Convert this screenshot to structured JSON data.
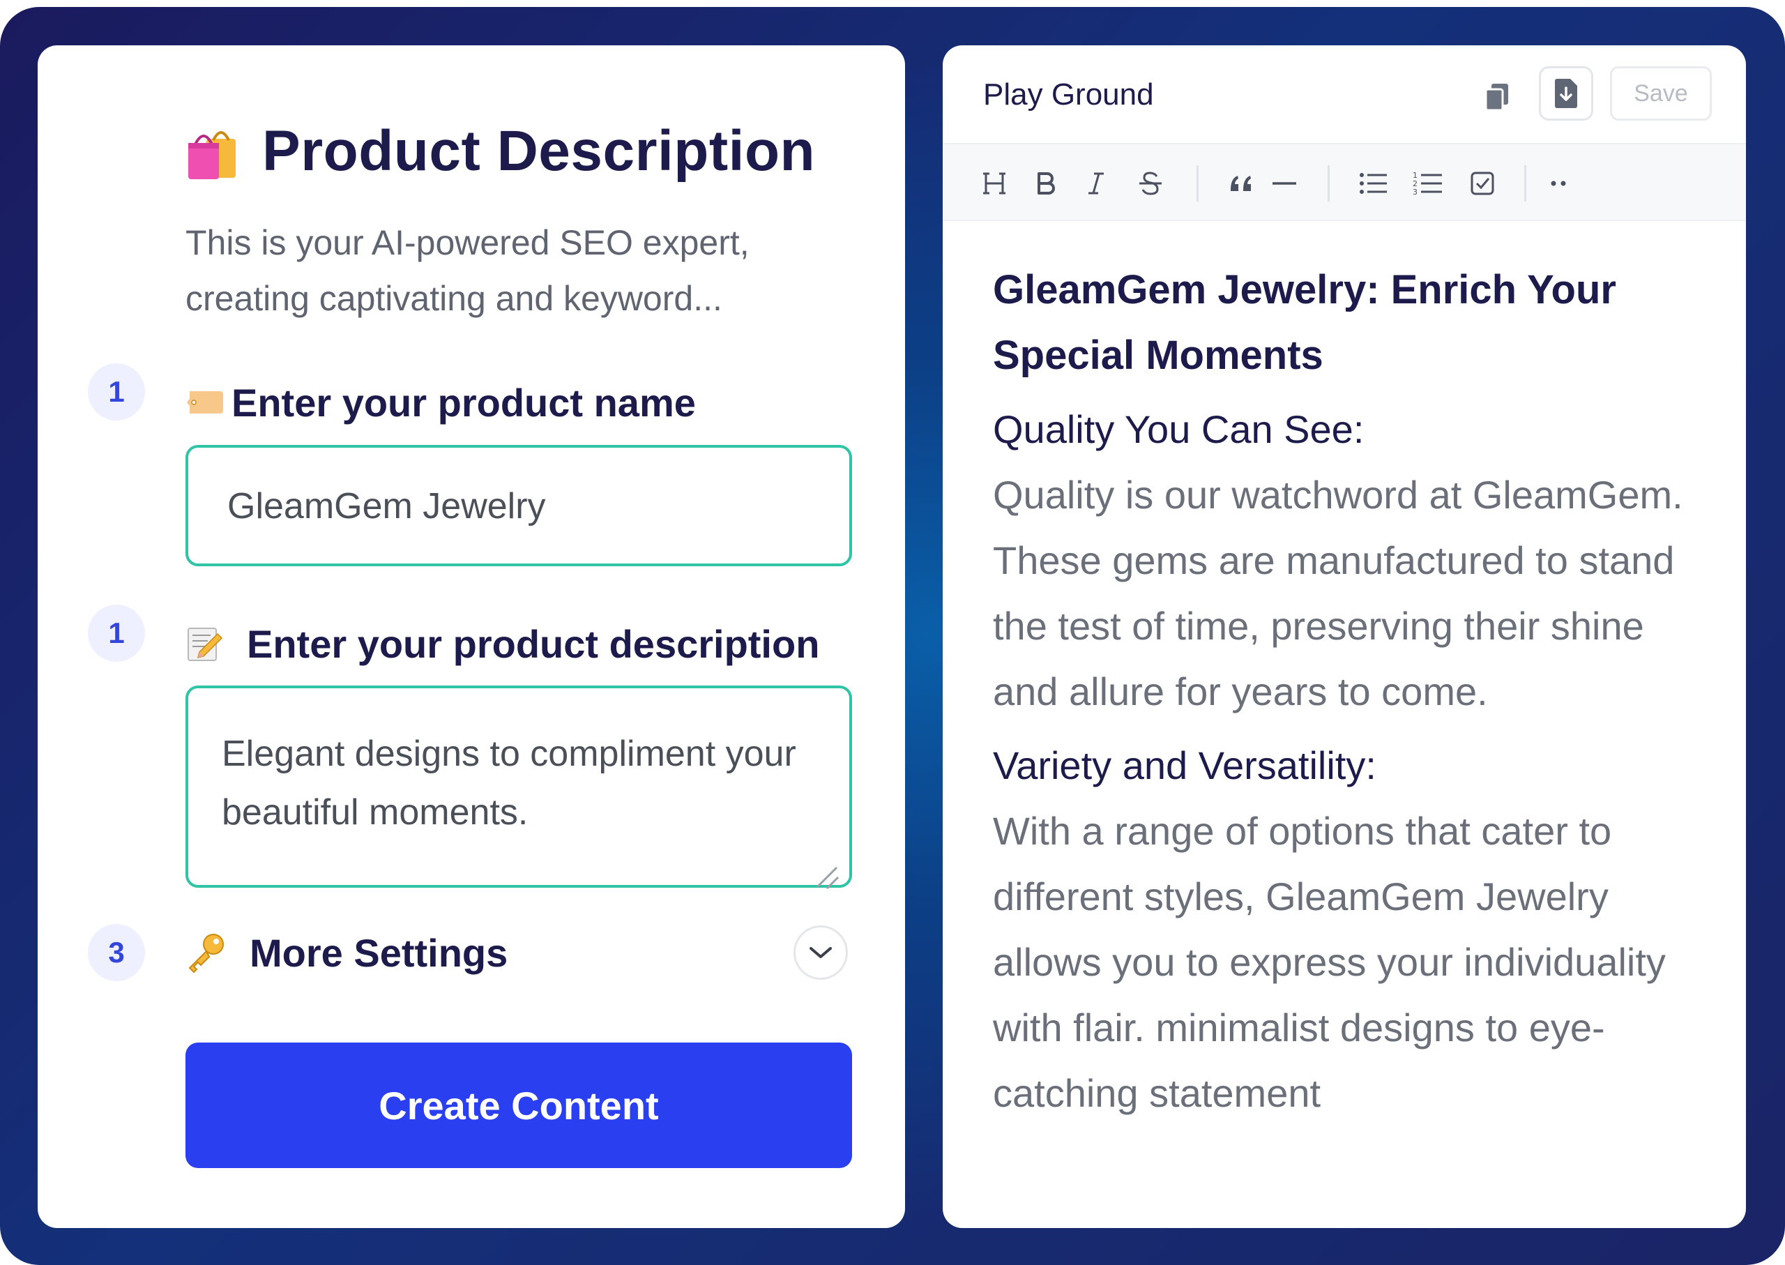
{
  "form": {
    "title": "Product Description",
    "subtitle": "This is your AI-powered SEO expert, creating captivating and keyword...",
    "steps": [
      {
        "number": "1",
        "label": "Enter your product name",
        "icon": "tag-icon"
      },
      {
        "number": "1",
        "label": "Enter your product description",
        "icon": "memo-icon"
      },
      {
        "number": "3",
        "label": "More Settings",
        "icon": "key-icon"
      }
    ],
    "product_name_value": "GleamGem Jewelry",
    "product_description_value": "Elegant designs to compliment your beautiful moments.",
    "create_button_label": "Create Content"
  },
  "playground": {
    "title": "Play Ground",
    "save_label": "Save",
    "toolbar_icons": [
      "heading-icon",
      "bold-icon",
      "italic-icon",
      "strikethrough-icon",
      "quote-icon",
      "horizontal-rule-icon",
      "bullet-list-icon",
      "ordered-list-icon",
      "checklist-icon",
      "more-icon"
    ],
    "document": {
      "heading": "GleamGem Jewelry: Enrich Your Special Moments",
      "sections": [
        {
          "heading": "Quality You Can See:",
          "body": "Quality is our watchword at GleamGem. These gems are manufactured to stand the test of time, preserving their shine and allure for years to come."
        },
        {
          "heading": "Variety and Versatility:",
          "body": "With a range of options that cater to different styles, GleamGem Jewelry allows you to express your individuality with flair.  minimalist designs to eye-catching statement"
        }
      ]
    }
  },
  "colors": {
    "accent": "#2a3ff0",
    "field_border": "#2fc4a6",
    "title_text": "#1d1b4b",
    "step_badge_bg": "#eef0ff"
  }
}
